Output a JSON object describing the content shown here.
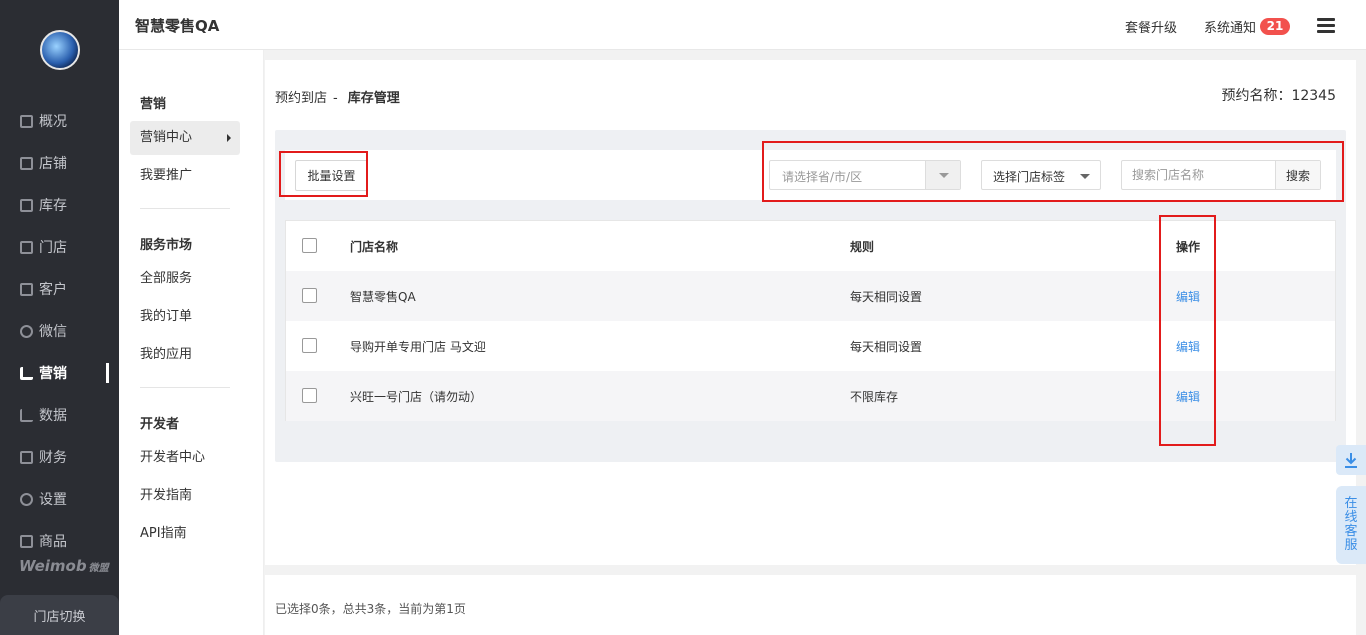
{
  "app": {
    "title": "智慧零售QA"
  },
  "header": {
    "upgrade_label": "套餐升级",
    "notice_label": "系统通知",
    "notice_count": "21"
  },
  "sidebar": {
    "items": [
      {
        "label": "概况"
      },
      {
        "label": "店铺"
      },
      {
        "label": "库存"
      },
      {
        "label": "门店"
      },
      {
        "label": "客户"
      },
      {
        "label": "微信"
      },
      {
        "label": "营销",
        "active": true
      },
      {
        "label": "数据"
      },
      {
        "label": "财务"
      },
      {
        "label": "设置"
      },
      {
        "label": "商品"
      }
    ],
    "brand": "Weimob",
    "brand_cn": "微盟",
    "store_switch": "门店切换"
  },
  "submenu": {
    "groups": [
      {
        "title": "营销",
        "items": [
          "营销中心",
          "我要推广"
        ]
      },
      {
        "title": "服务市场",
        "items": [
          "全部服务",
          "我的订单",
          "我的应用"
        ]
      },
      {
        "title": "开发者",
        "items": [
          "开发者中心",
          "开发指南",
          "API指南"
        ]
      }
    ]
  },
  "breadcrumb": {
    "parent": "预约到店",
    "separator": "-",
    "current": "库存管理"
  },
  "appointment": {
    "label": "预约名称：",
    "value": "12345"
  },
  "toolbar": {
    "batch_label": "批量设置",
    "region_placeholder": "请选择省/市/区",
    "tag_label": "选择门店标签",
    "search_placeholder": "搜索门店名称",
    "search_button": "搜索"
  },
  "table": {
    "columns": [
      "门店名称",
      "规则",
      "操作"
    ],
    "rows": [
      {
        "name": "智慧零售QA",
        "rule": "每天相同设置",
        "action": "编辑"
      },
      {
        "name": "导购开单专用门店 马文迎",
        "rule": "每天相同设置",
        "action": "编辑"
      },
      {
        "name": "兴旺一号门店（请勿动）",
        "rule": "不限库存",
        "action": "编辑"
      }
    ]
  },
  "pager": {
    "summary": "已选择0条，总共3条，当前为第1页"
  },
  "float": {
    "service_label": [
      "在",
      "线",
      "客",
      "服"
    ]
  },
  "colors": {
    "sidebar_bg": "#2b2d33",
    "link": "#3a8ee6",
    "badge": "#f2514d",
    "annotation": "#e21b1b"
  }
}
